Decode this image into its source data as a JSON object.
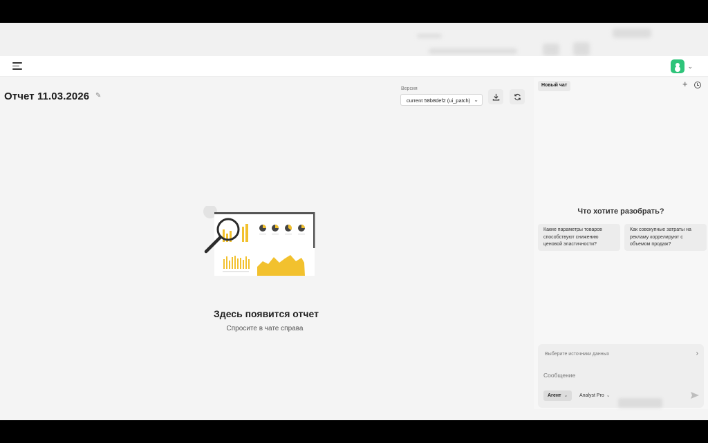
{
  "header": {
    "menu_icon": "menu-icon",
    "avatar_icon": "user-avatar-icon",
    "avatar_color": "#2ec47a"
  },
  "report": {
    "title": "Отчет 11.03.2026",
    "version_label": "Версия",
    "version_selected": "current 58b8def2 (ui_patch)",
    "empty_title": "Здесь появится отчет",
    "empty_subtitle": "Спросите в чате справа",
    "illustration_accent": "#f2c12e"
  },
  "chat": {
    "tab_label": "Новый чат",
    "prompt": "Что хотите разобрать?",
    "suggestions": [
      "Какие параметры товаров способствуют снижению ценовой эластичности?",
      "Как совокупные затраты на рекламу коррелируют с объемом продаж?"
    ],
    "sources_label": "Выберите источники данных",
    "message_placeholder": "Сообщение",
    "mode_label": "Агент",
    "model_label": "Analyst Pro"
  }
}
